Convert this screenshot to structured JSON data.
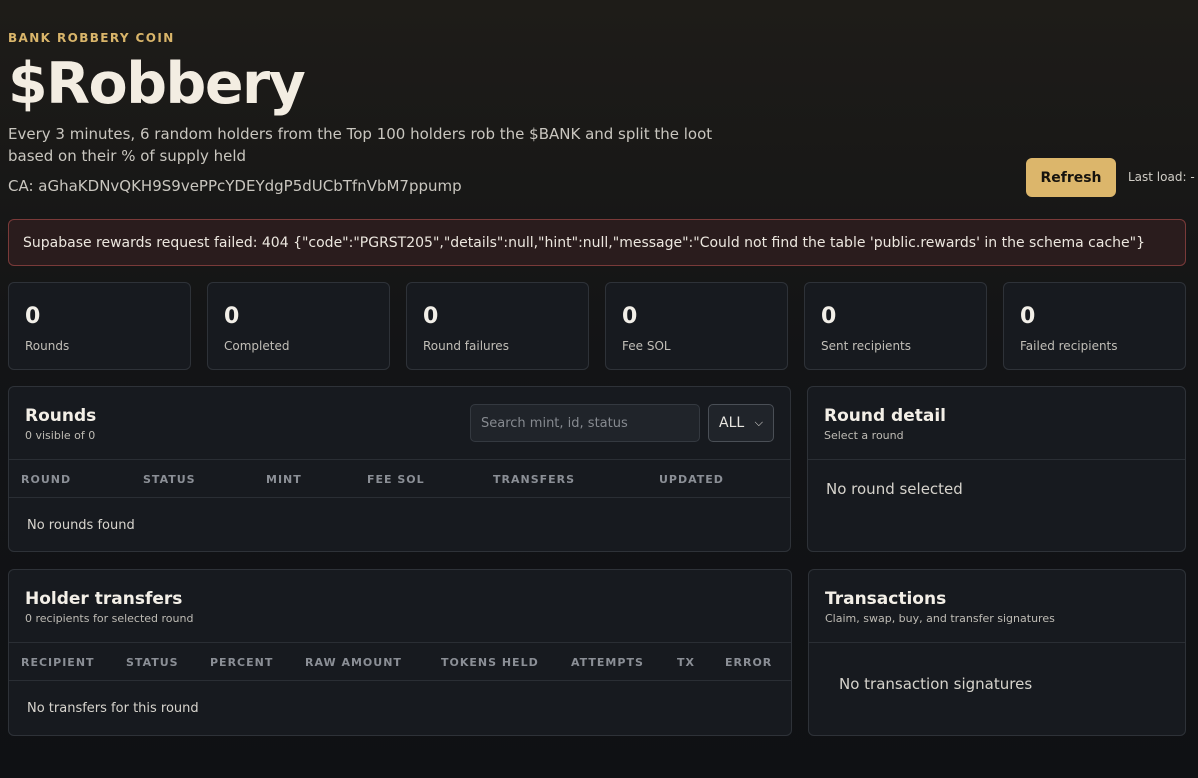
{
  "header": {
    "eyebrow": "BANK ROBBERY COIN",
    "title": "$Robbery",
    "tagline": "Every 3 minutes, 6 random holders from the Top 100 holders rob the $BANK and split the loot based on their % of supply held",
    "ca": "CA: aGhaKDNvQKH9S9vePPcYDEYdgP5dUCbTfnVbM7ppump",
    "refresh_label": "Refresh",
    "last_load": "Last load: -"
  },
  "error": "Supabase rewards request failed: 404 {\"code\":\"PGRST205\",\"details\":null,\"hint\":null,\"message\":\"Could not find the table 'public.rewards' in the schema cache\"}",
  "stats": [
    {
      "value": "0",
      "label": "Rounds"
    },
    {
      "value": "0",
      "label": "Completed"
    },
    {
      "value": "0",
      "label": "Round failures"
    },
    {
      "value": "0",
      "label": "Fee SOL"
    },
    {
      "value": "0",
      "label": "Sent recipients"
    },
    {
      "value": "0",
      "label": "Failed recipients"
    }
  ],
  "rounds": {
    "title": "Rounds",
    "subtitle": "0 visible of 0",
    "search_placeholder": "Search mint, id, status",
    "filter_value": "ALL",
    "columns": [
      "ROUND",
      "STATUS",
      "MINT",
      "FEE SOL",
      "TRANSFERS",
      "UPDATED"
    ],
    "empty": "No rounds found"
  },
  "detail": {
    "title": "Round detail",
    "subtitle": "Select a round",
    "empty": "No round selected"
  },
  "transfers": {
    "title": "Holder transfers",
    "subtitle": "0 recipients for selected round",
    "columns": [
      "RECIPIENT",
      "STATUS",
      "PERCENT",
      "RAW AMOUNT",
      "TOKENS HELD",
      "ATTEMPTS",
      "TX",
      "ERROR"
    ],
    "empty": "No transfers for this round"
  },
  "transactions": {
    "title": "Transactions",
    "subtitle": "Claim, swap, buy, and transfer signatures",
    "empty": "No transaction signatures"
  },
  "colors": {
    "accent": "#dcb66b",
    "error_border": "#7a3a39",
    "card_bg": "#171a1f"
  }
}
